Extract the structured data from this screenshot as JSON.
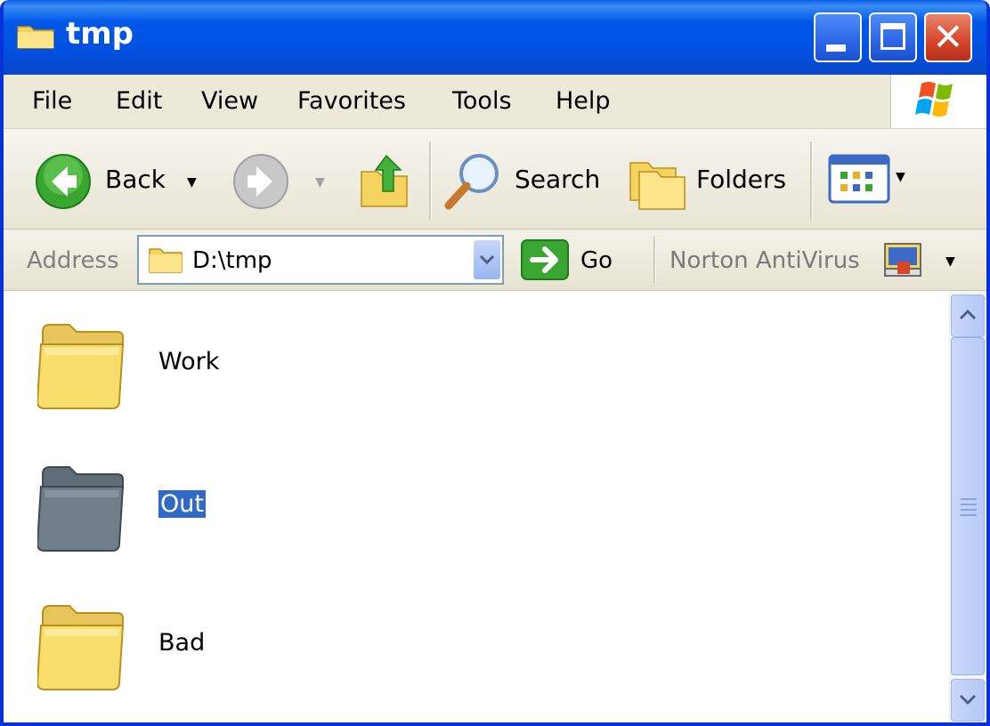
{
  "window": {
    "title": "tmp",
    "title_color": "#0058e8"
  },
  "menu": {
    "items": [
      "File",
      "Edit",
      "View",
      "Favorites",
      "Tools",
      "Help"
    ]
  },
  "toolbar": {
    "back_label": "Back",
    "search_label": "Search",
    "folders_label": "Folders"
  },
  "address": {
    "label": "Address",
    "value": "D:\\tmp",
    "go_label": "Go",
    "norton_label": "Norton AntiVirus"
  },
  "files": [
    {
      "name": "Work",
      "selected": false,
      "icon": "folder-icon"
    },
    {
      "name": "Out",
      "selected": true,
      "icon": "folder-icon"
    },
    {
      "name": "Bad",
      "selected": false,
      "icon": "folder-icon"
    }
  ],
  "colors": {
    "selection": "#316ac5",
    "folder_yellow": "#f7dd6b",
    "folder_selected": "#6f7e88"
  }
}
